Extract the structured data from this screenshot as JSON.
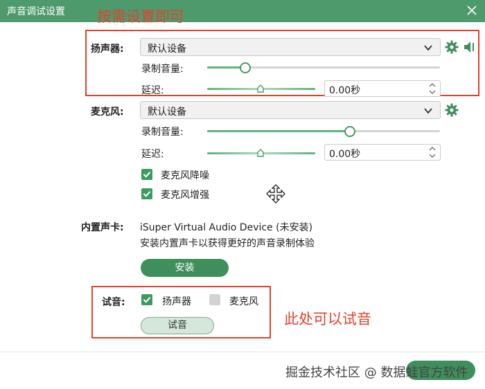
{
  "window": {
    "title": "声音调试设置",
    "close_icon": "close-icon"
  },
  "annotations": {
    "top": "按需设置即可",
    "test": "此处可以试音"
  },
  "speaker": {
    "label": "扬声器:",
    "device": "默认设备",
    "volume_label": "录制音量:",
    "volume_fraction": 0.16,
    "delay_label": "延迟:",
    "delay_fraction": 0.5,
    "delay_value": "0.00秒"
  },
  "mic": {
    "label": "麦克风:",
    "device": "默认设备",
    "volume_label": "录制音量:",
    "volume_fraction": 0.61,
    "delay_label": "延迟:",
    "delay_fraction": 0.5,
    "delay_value": "0.00秒",
    "noise_reduction": {
      "label": "麦克风降噪",
      "checked": true
    },
    "enhance": {
      "label": "麦克风增强",
      "checked": true
    }
  },
  "soundcard": {
    "label": "内置声卡:",
    "device_name": "iSuper Virtual Audio Device (未安装)",
    "hint": "安装内置声卡以获得更好的声音录制体验",
    "install_label": "安装"
  },
  "test": {
    "label": "试音:",
    "speaker_check": {
      "label": "扬声器",
      "checked": true
    },
    "mic_check": {
      "label": "麦克风",
      "checked": false
    },
    "button_label": "试音"
  },
  "watermark": "掘金技术社区 @ 数据蛙官方软件",
  "colors": {
    "accent": "#4e9a6d",
    "annotation": "#e2412a"
  }
}
